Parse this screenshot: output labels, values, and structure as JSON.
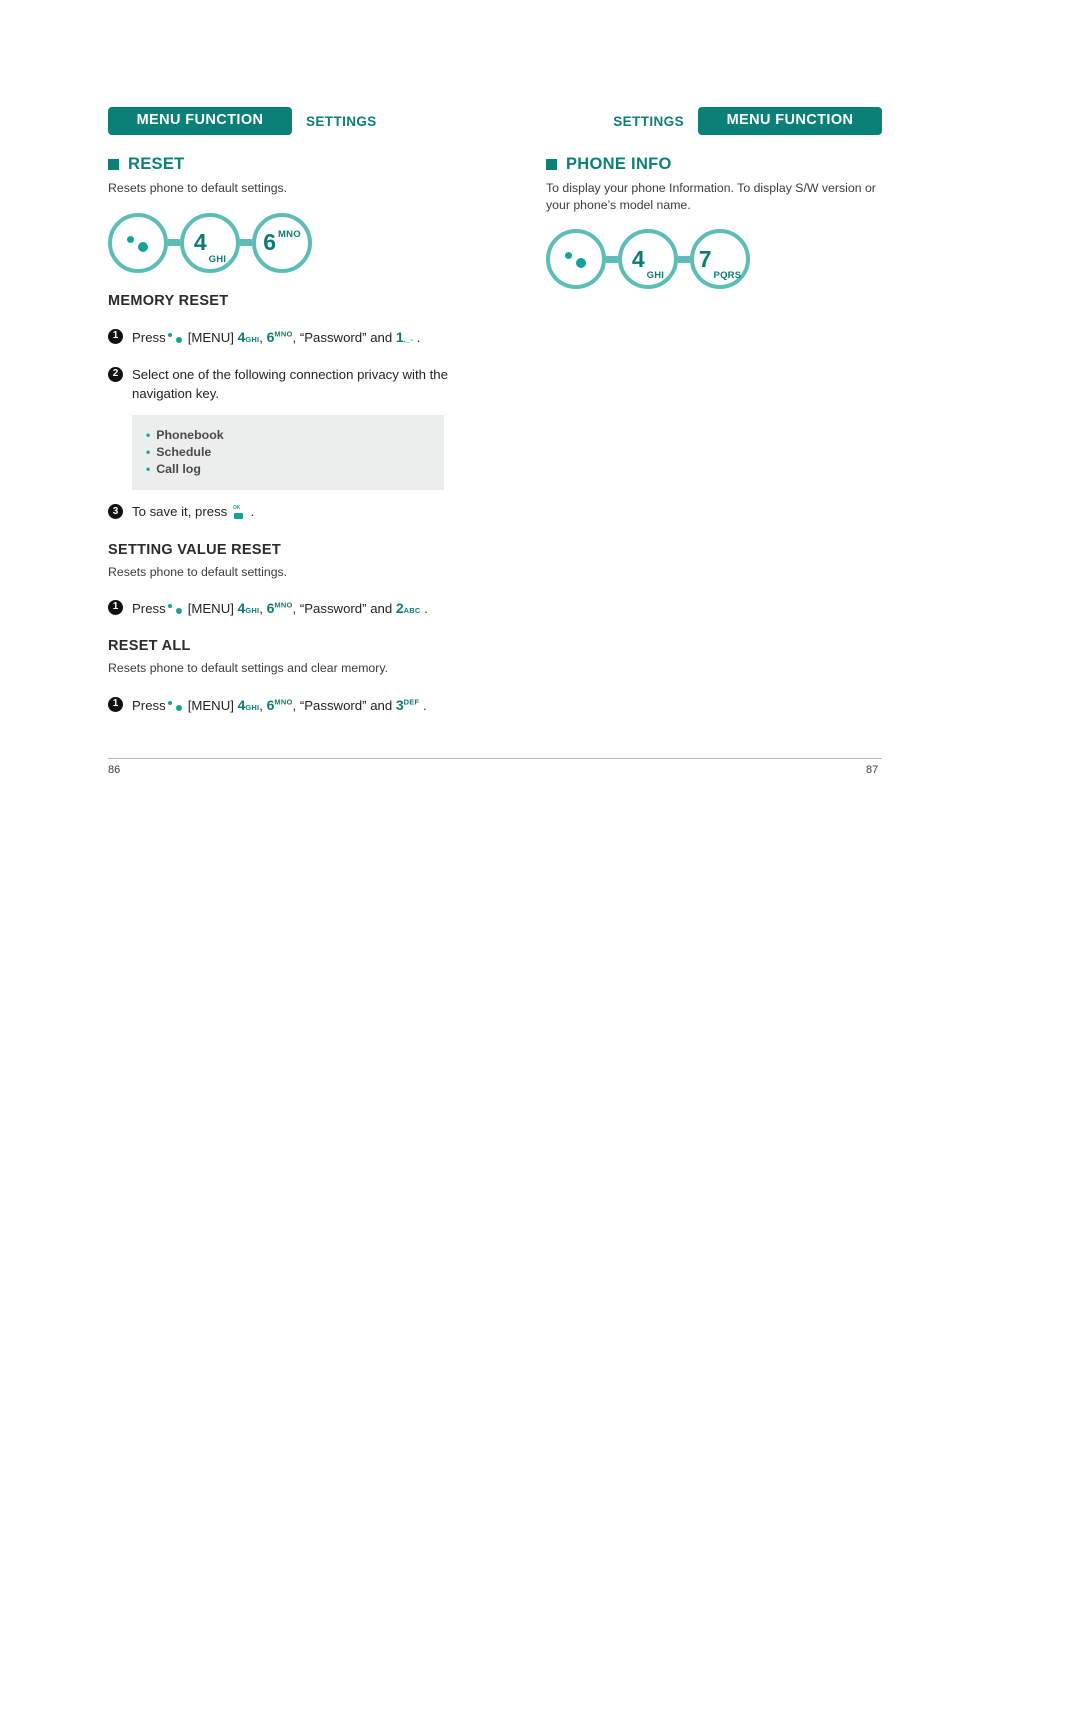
{
  "left_page": {
    "header": {
      "chip_label": "MENU FUNCTION",
      "sub_label": "SETTINGS"
    },
    "section": {
      "title": "RESET",
      "lede": "Resets phone to default settings."
    },
    "keyseq": [
      {
        "icon": "menu-dots-icon",
        "num": "",
        "sub": ""
      },
      {
        "icon": "",
        "num": "4",
        "sub": "GHI"
      },
      {
        "icon": "",
        "num": "6",
        "sub": "MNO"
      }
    ],
    "memory_reset": {
      "heading": "MEMORY RESET",
      "steps": [
        {
          "num": "1",
          "prefix": "Press",
          "menu_label": "[MENU]",
          "keys": [
            {
              "num": "4",
              "sub": "GHI",
              "pos": "sub"
            },
            {
              "num": "6",
              "sub": "MNO",
              "pos": "sup"
            }
          ],
          "mid": "“Password” and",
          "final_key": {
            "num": "1",
            "sub": "._-",
            "pos": "sub"
          },
          "suffix": "."
        },
        {
          "num": "2",
          "text": "Select one of the following connection privacy with the navigation key."
        },
        {
          "num": "3",
          "text_before": "To save it, press",
          "icon": "ok-key-icon",
          "text_after": "."
        }
      ],
      "options": [
        "Phonebook",
        "Schedule",
        "Call log"
      ]
    },
    "setting_value_reset": {
      "heading": "SETTING VALUE RESET",
      "lede": "Resets phone to default settings.",
      "step": {
        "num": "1",
        "prefix": "Press",
        "menu_label": "[MENU]",
        "keys": [
          {
            "num": "4",
            "sub": "GHI",
            "pos": "sub"
          },
          {
            "num": "6",
            "sub": "MNO",
            "pos": "sup"
          }
        ],
        "mid": "“Password” and",
        "final_key": {
          "num": "2",
          "sub": "ABC",
          "pos": "sub"
        },
        "suffix": "."
      }
    },
    "reset_all": {
      "heading": "RESET ALL",
      "lede": "Resets phone to default settings and clear memory.",
      "step": {
        "num": "1",
        "prefix": "Press",
        "menu_label": "[MENU]",
        "keys": [
          {
            "num": "4",
            "sub": "GHI",
            "pos": "sub"
          },
          {
            "num": "6",
            "sub": "MNO",
            "pos": "sup"
          }
        ],
        "mid": "“Password” and",
        "final_key": {
          "num": "3",
          "sub": "DEF",
          "pos": "sup"
        },
        "suffix": "."
      }
    },
    "page_number": "86"
  },
  "right_page": {
    "header": {
      "chip_label": "MENU FUNCTION",
      "sub_label": "SETTINGS"
    },
    "section": {
      "title": "PHONE INFO",
      "lede": "To display your phone Information. To display S/W version or your phone’s model name."
    },
    "keyseq": [
      {
        "icon": "menu-dots-icon",
        "num": "",
        "sub": ""
      },
      {
        "icon": "",
        "num": "4",
        "sub": "GHI"
      },
      {
        "icon": "",
        "num": "7",
        "sub": "PQRS"
      }
    ],
    "page_number": "87"
  },
  "colors": {
    "brand_teal": "#0b8077",
    "light_teal": "#5cbcb6",
    "key_teal": "#0b7c74",
    "box_gray": "#eceded"
  }
}
